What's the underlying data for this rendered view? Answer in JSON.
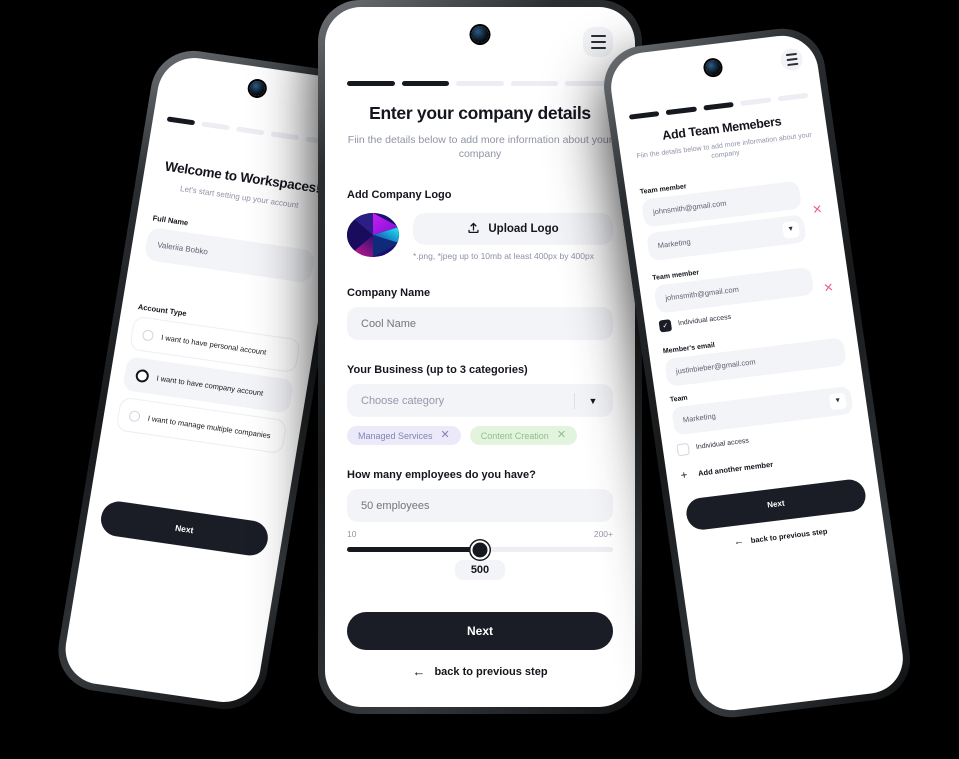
{
  "brand": {
    "dark": "#1b1d26",
    "muted": "#9094a6",
    "field_bg": "#f3f4f8",
    "danger": "#f2618f"
  },
  "screen1": {
    "name": "welcome-screen",
    "steps": {
      "total": 5,
      "active": 1
    },
    "menu_icon": "hamburger-icon",
    "title": "Welcome to Workspaces!",
    "subtitle": "Let's start setting up your account",
    "full_name": {
      "label": "Full Name",
      "value": "Valeriia Bobko"
    },
    "account_type": {
      "label": "Account Type",
      "options": [
        {
          "label": "I want to have personal account",
          "selected": false
        },
        {
          "label": "I want to have company account",
          "selected": true
        },
        {
          "label": "I want to manage multiple companies",
          "selected": false
        }
      ]
    },
    "next_label": "Next"
  },
  "screen2": {
    "name": "company-details-screen",
    "steps": {
      "total": 5,
      "active": 2
    },
    "menu_icon": "hamburger-icon",
    "title": "Enter your company details",
    "subtitle": "Fiin the details below to add more information about your company",
    "logo": {
      "label": "Add Company Logo",
      "upload_label": "Upload Logo",
      "upload_icon": "upload-icon",
      "hint": "*.png, *jpeg up to 10mb at least 400px by 400px"
    },
    "company_name": {
      "label": "Company Name",
      "placeholder": "Cool Name"
    },
    "business": {
      "label": "Your Business (up to 3 categories)",
      "placeholder": "Choose category",
      "dropdown_icon": "chevron-down-icon",
      "chips": [
        {
          "label": "Managed Services",
          "color": "violet",
          "remove_icon": "close-icon"
        },
        {
          "label": "Content Creation",
          "color": "green",
          "remove_icon": "close-icon"
        }
      ]
    },
    "employees": {
      "label": "How many employees do you have?",
      "placeholder": "50 employees",
      "min_label": "10",
      "max_label": "200+",
      "slider_percent": 50,
      "value": "500"
    },
    "next_label": "Next",
    "back_label": "back to previous step",
    "back_icon": "arrow-left-icon"
  },
  "screen3": {
    "name": "add-team-members-screen",
    "steps": {
      "total": 5,
      "active": 3
    },
    "menu_icon": "hamburger-icon",
    "title": "Add Team Memebers",
    "subtitle": "Fiin the details below to add more information about your company",
    "members": [
      {
        "label": "Team member",
        "email": "johnsmith@gmail.com",
        "team": "Marketing",
        "remove_icon": "close-icon",
        "dropdown_icon": "chevron-down-icon"
      },
      {
        "label": "Team member",
        "email": "johnsmith@gmail.com",
        "checkbox_label": "Individual access",
        "checked": true,
        "remove_icon": "close-icon"
      }
    ],
    "new_member": {
      "email_label": "Member's email",
      "email_value": "justinbieber@gmail.com",
      "team_label": "Team",
      "team_value": "Marketing",
      "dropdown_icon": "chevron-down-icon",
      "checkbox_label": "Individual access",
      "checked": false
    },
    "add_another": {
      "label": "Add another member",
      "icon": "plus-icon"
    },
    "next_label": "Next",
    "back_label": "back to previous step",
    "back_icon": "arrow-left-icon"
  }
}
